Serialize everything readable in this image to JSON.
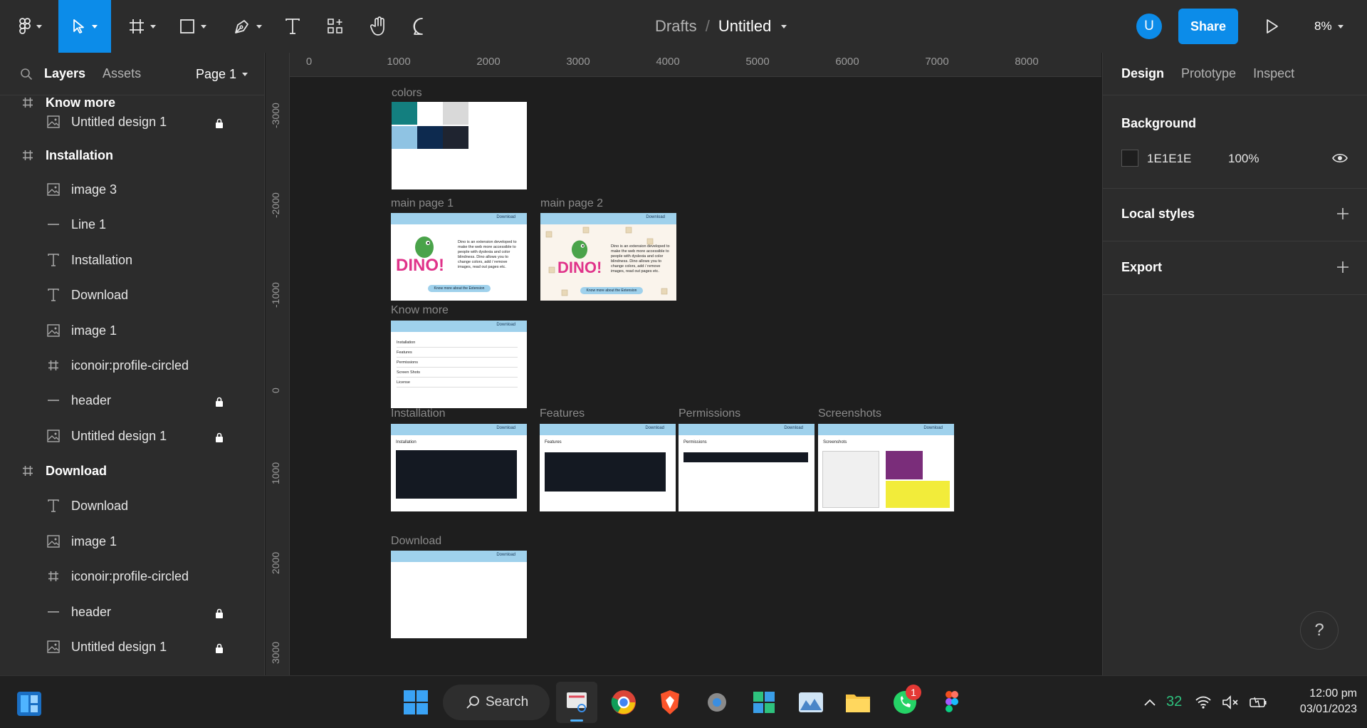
{
  "toolbar": {
    "breadcrumb_parent": "Drafts",
    "breadcrumb_separator": "/",
    "file_name": "Untitled",
    "avatar_initial": "U",
    "share_label": "Share",
    "zoom_level": "8%",
    "accent_color": "#0c8ce9"
  },
  "left_panel": {
    "tabs": [
      "Layers",
      "Assets"
    ],
    "page_selector": "Page 1",
    "layers": [
      {
        "label": "Know more",
        "icon": "frame-icon",
        "type": "frame"
      },
      {
        "label": "Untitled design 1",
        "icon": "image-icon",
        "type": "child",
        "locked": true
      },
      {
        "label": "Installation",
        "icon": "frame-icon",
        "type": "frame"
      },
      {
        "label": "image 3",
        "icon": "image-icon",
        "type": "child"
      },
      {
        "label": "Line 1",
        "icon": "line-icon",
        "type": "child"
      },
      {
        "label": "Installation",
        "icon": "text-icon",
        "type": "child"
      },
      {
        "label": "Download",
        "icon": "text-icon",
        "type": "child"
      },
      {
        "label": "image 1",
        "icon": "image-icon",
        "type": "child"
      },
      {
        "label": "iconoir:profile-circled",
        "icon": "frame-icon",
        "type": "child"
      },
      {
        "label": "header",
        "icon": "line-icon",
        "type": "child",
        "locked": true
      },
      {
        "label": "Untitled design 1",
        "icon": "image-icon",
        "type": "child",
        "locked": true
      },
      {
        "label": "Download",
        "icon": "frame-icon",
        "type": "frame"
      },
      {
        "label": "Download",
        "icon": "text-icon",
        "type": "child"
      },
      {
        "label": "image 1",
        "icon": "image-icon",
        "type": "child"
      },
      {
        "label": "iconoir:profile-circled",
        "icon": "frame-icon",
        "type": "child"
      },
      {
        "label": "header",
        "icon": "line-icon",
        "type": "child",
        "locked": true
      },
      {
        "label": "Untitled design 1",
        "icon": "image-icon",
        "type": "child",
        "locked": true
      }
    ]
  },
  "canvas": {
    "ruler_x": [
      "0",
      "1000",
      "2000",
      "3000",
      "4000",
      "5000",
      "6000",
      "7000",
      "8000"
    ],
    "ruler_y": [
      "-3000",
      "-2000",
      "-1000",
      "0",
      "1000",
      "2000",
      "3000"
    ],
    "frames": {
      "colors": "colors",
      "main1": "main page 1",
      "main2": "main page 2",
      "know": "Know more",
      "install": "Installation",
      "features": "Features",
      "permissions": "Permissions",
      "screenshots": "Screenshots",
      "download": "Download"
    },
    "frame_header_link": "Download",
    "dino_title": "DINO!",
    "dino_blurb": "Dino is an extension developed to make the web more accessible to people with dyslexia and color blindness. Dino allows you to change colors, add / remove images, read out pages etc.",
    "dino_button": "Know more about the Extension",
    "know_more_items": [
      "Installation",
      "Features",
      "Permissions",
      "Screen Shots",
      "License"
    ],
    "swatches": [
      "#137f7f",
      "#ffffff",
      "#d9d9d9",
      "#8fc3e3",
      "#0d2a4f",
      "#1f2430"
    ]
  },
  "right_panel": {
    "tabs": [
      "Design",
      "Prototype",
      "Inspect"
    ],
    "background_title": "Background",
    "background_hex": "1E1E1E",
    "background_opacity": "100%",
    "local_styles": "Local styles",
    "export": "Export"
  },
  "help_label": "?",
  "taskbar": {
    "search_label": "Search",
    "battery_count": "32",
    "whatsapp_badge": "1",
    "time": "12:00 pm",
    "date": "03/01/2023"
  }
}
